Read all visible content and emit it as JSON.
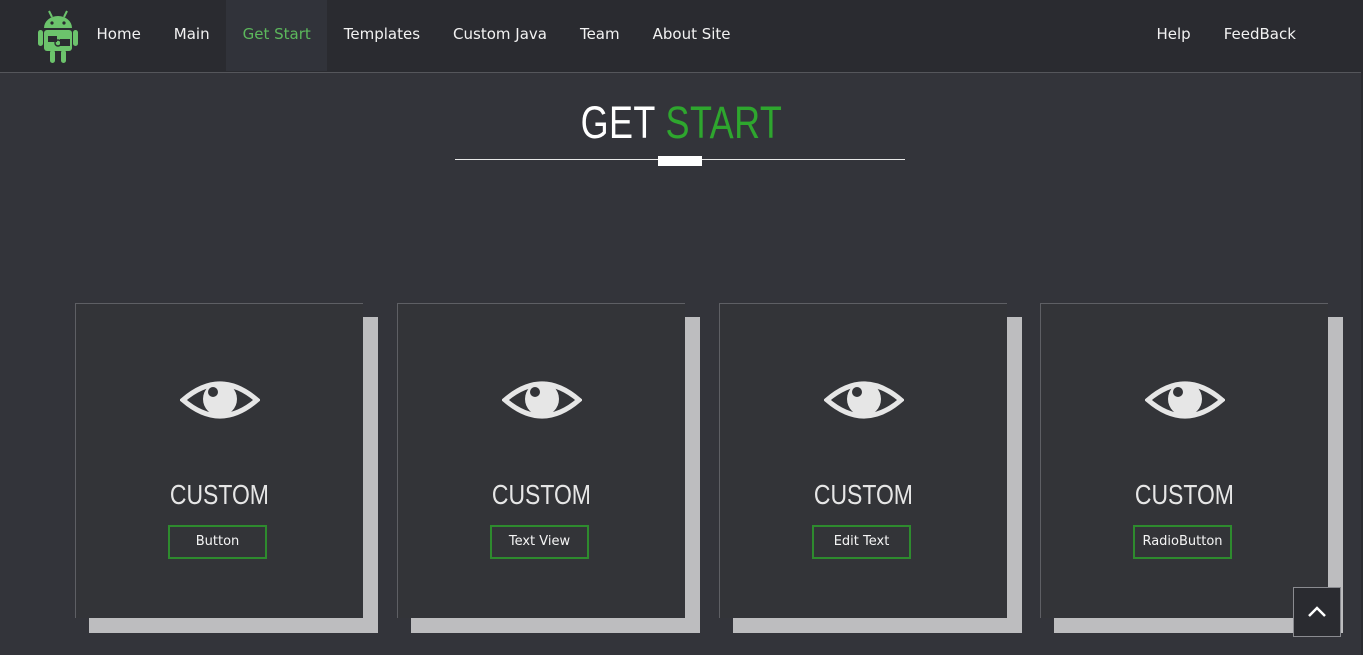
{
  "nav": {
    "items_left": [
      {
        "label": "Home",
        "active": false
      },
      {
        "label": "Main",
        "active": false
      },
      {
        "label": "Get Start",
        "active": true
      },
      {
        "label": "Templates",
        "active": false
      },
      {
        "label": "Custom Java",
        "active": false
      },
      {
        "label": "Team",
        "active": false
      },
      {
        "label": "About Site",
        "active": false
      }
    ],
    "items_right": [
      {
        "label": "Help"
      },
      {
        "label": "FeedBack"
      }
    ],
    "logo_icon": "android-icon"
  },
  "heading": {
    "part1": "GET",
    "part2": "START"
  },
  "cards": [
    {
      "title": "CUSTOM",
      "button": "Button",
      "icon": "eye-icon"
    },
    {
      "title": "CUSTOM",
      "button": "Text View",
      "icon": "eye-icon"
    },
    {
      "title": "CUSTOM",
      "button": "Edit Text",
      "icon": "eye-icon"
    },
    {
      "title": "CUSTOM",
      "button": "RadioButton",
      "icon": "eye-icon"
    }
  ],
  "scroll_top_icon": "chevron-up-icon",
  "colors": {
    "background": "#33343a",
    "navbar": "#2a2b30",
    "accent": "#2ea62e",
    "active_nav": "#5cb85c",
    "button_border": "#2e8b2e"
  }
}
